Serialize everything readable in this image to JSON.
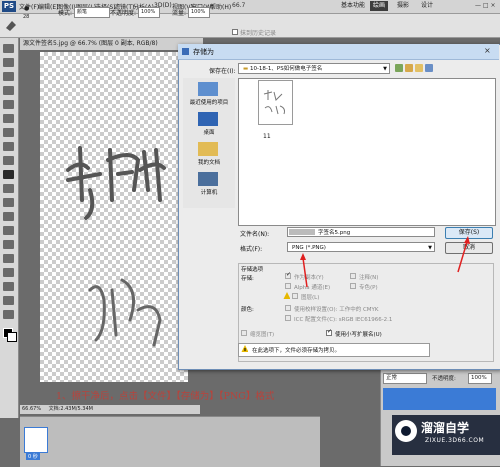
{
  "app": {
    "logo": "PS",
    "menu": [
      "文件(F)",
      "编辑(E)",
      "图像(I)",
      "图层(L)",
      "选择(S)",
      "滤镜(T)",
      "分析(A)",
      "3D(D)",
      "视图(V)",
      "窗口(W)",
      "帮助(H)"
    ],
    "zoom": "66.7",
    "workspace_buttons": [
      "基本功能",
      "绘画",
      "摄影",
      "设计"
    ],
    "workspace_active": 1
  },
  "options_bar": {
    "size": "28",
    "mode_label": "模式:",
    "mode_value": "颜笔",
    "opacity_label": "不透明度:",
    "opacity_value": "100%",
    "flow_label": "流量:",
    "flow_value": "100%",
    "history_label": "抹到历史记录"
  },
  "document": {
    "tab_title": "源文件签名5.jpg @ 66.7% (图层 0 副本, RGB/8)",
    "status_zoom": "66.67%",
    "status_doc": "文档:2.43M/5.34M",
    "anim_frame_time": "0 秒"
  },
  "caption": "1、擦干净后，点击【文件】【存储为】【PNG】格式",
  "right_panel": {
    "blend_mode": "正常",
    "opacity_label": "不透明度:",
    "opacity_value": "100%"
  },
  "watermark": {
    "title": "溜溜自学",
    "subtitle": "ZIXUE.3D66.COM"
  },
  "dialog": {
    "title": "存储为",
    "save_in_label": "保存在(I):",
    "save_in_value": "10-18-1、PS如何做电子签名",
    "places": [
      "最近使用的项目",
      "桌面",
      "我的文档",
      "计算机"
    ],
    "thumbnail_label": "11",
    "filename_label": "文件名(N):",
    "filename_value": "字签名5.png",
    "format_label": "格式(F):",
    "format_value": "PNG (*.PNG)",
    "save_button": "保存(S)",
    "cancel_button": "取消",
    "storage_options_label": "存储选项",
    "storage_label": "存储:",
    "options": {
      "as_copy": "作为副本(Y)",
      "notes": "注释(N)",
      "alpha": "Alpha 通道(E)",
      "spot": "专色(P)",
      "layers": "图层(L)"
    },
    "color_label": "颜色:",
    "use_proof": "使用校样设置(O): 工作中的 CMYK",
    "icc_profile": "ICC 配置文件(C): sRGB IEC61966-2.1",
    "thumbnail_option": "缩览图(T)",
    "lowercase_ext": "使用小写扩展名(U)",
    "warning": "在此选项下，文件必须存储为拷贝。"
  }
}
